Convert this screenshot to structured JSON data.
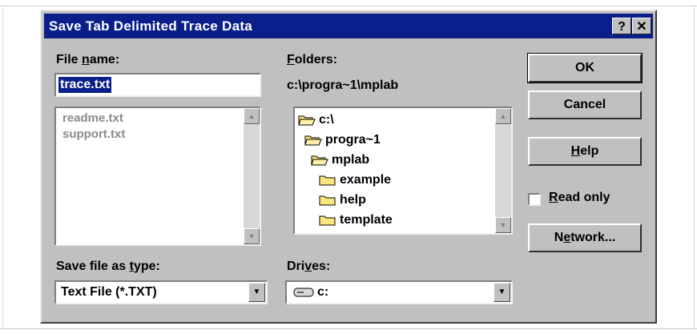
{
  "dialog": {
    "title": "Save Tab Delimited Trace Data",
    "help_button": "?",
    "close_button": "✕"
  },
  "file_name": {
    "label_pre": "File ",
    "label_key": "n",
    "label_post": "ame:",
    "value": "trace.txt",
    "files": [
      "readme.txt",
      "support.txt"
    ]
  },
  "folders": {
    "label_key": "F",
    "label_post": "olders:",
    "current_path": "c:\\progra~1\\mplab",
    "items": [
      {
        "name": "c:\\",
        "state": "open"
      },
      {
        "name": "progra~1",
        "state": "open"
      },
      {
        "name": "mplab",
        "state": "open"
      },
      {
        "name": "example",
        "state": "closed"
      },
      {
        "name": "help",
        "state": "closed"
      },
      {
        "name": "template",
        "state": "closed"
      }
    ]
  },
  "save_type": {
    "label_pre": "Save file as ",
    "label_key": "t",
    "label_post": "ype:",
    "value": "Text File (*.TXT)"
  },
  "drives": {
    "label_pre": "Dri",
    "label_key": "v",
    "label_post": "es:",
    "value": "c:"
  },
  "buttons": {
    "ok": "OK",
    "cancel": "Cancel",
    "help_key": "H",
    "help_post": "elp",
    "network_pre": "N",
    "network_key": "e",
    "network_post": "twork..."
  },
  "read_only": {
    "label_key": "R",
    "label_post": "ead only",
    "checked": false
  },
  "colors": {
    "titlebar": "#0b1f8a",
    "dialog_face": "#c0c0c0",
    "selection": "#0b1f8a",
    "folder_yellow": "#ffe67a"
  }
}
